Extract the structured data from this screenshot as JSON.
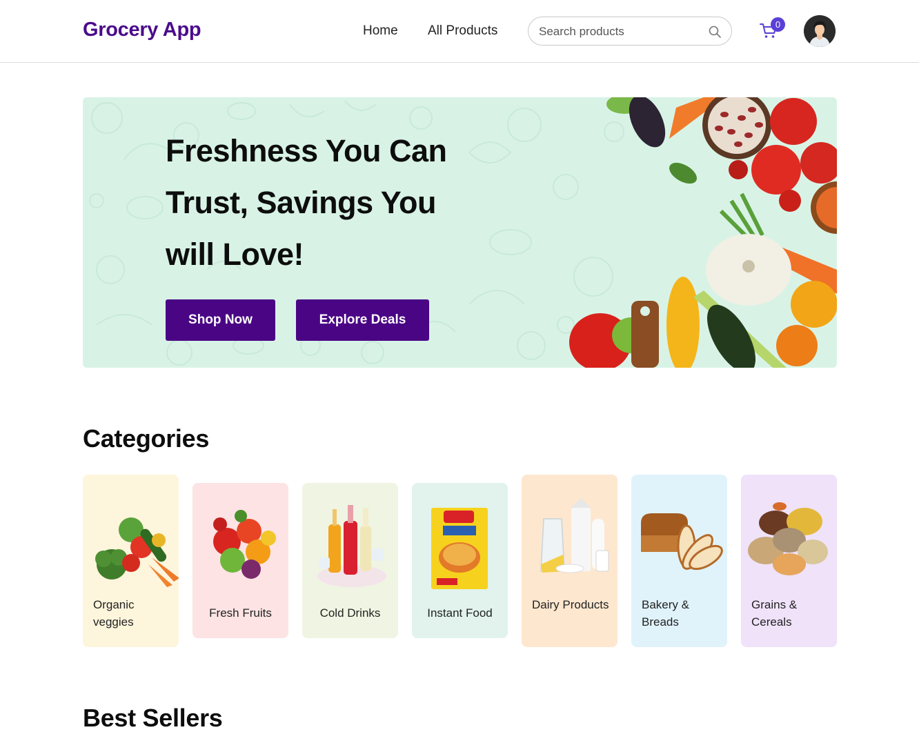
{
  "header": {
    "logo": "Grocery App",
    "nav": [
      {
        "label": "Home"
      },
      {
        "label": "All Products"
      }
    ],
    "search_placeholder": "Search products",
    "cart_count": "0"
  },
  "hero": {
    "title": "Freshness You Can Trust, Savings You will Love!",
    "primary_button": "Shop Now",
    "secondary_button": "Explore Deals",
    "background_color": "#d8f3e6",
    "button_color": "#4a0585"
  },
  "categories": {
    "title": "Categories",
    "items": [
      {
        "label": "Organic veggies",
        "color": "#fdf5dc",
        "icon": "vegetables-icon"
      },
      {
        "label": "Fresh Fruits",
        "color": "#fde3e4",
        "icon": "fruits-icon"
      },
      {
        "label": "Cold Drinks",
        "color": "#eff5e2",
        "icon": "cold-drinks-icon"
      },
      {
        "label": "Instant Food",
        "color": "#e1f3ec",
        "icon": "instant-noodles-icon"
      },
      {
        "label": "Dairy Products",
        "color": "#fde7cf",
        "icon": "dairy-icon"
      },
      {
        "label": "Bakery & Breads",
        "color": "#e0f3fb",
        "icon": "bread-icon"
      },
      {
        "label": "Grains & Cereals",
        "color": "#efe2f9",
        "icon": "grains-icon"
      }
    ]
  },
  "best_sellers": {
    "title": "Best Sellers"
  },
  "colors": {
    "brand": "#4b0c8c",
    "badge": "#5b3fd6"
  }
}
